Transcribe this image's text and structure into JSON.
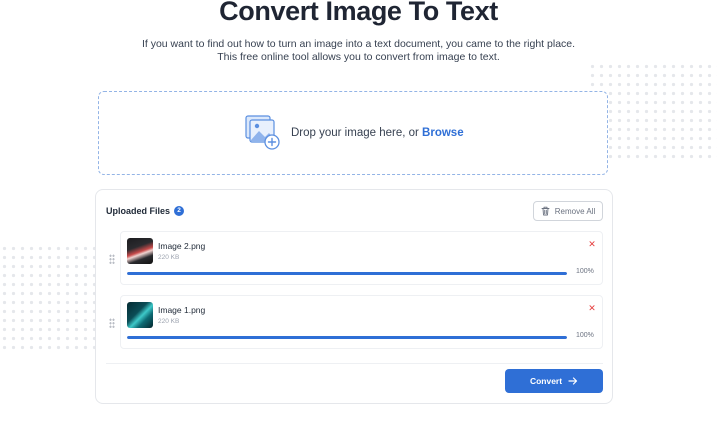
{
  "header": {
    "title": "Convert Image To Text",
    "subtitle": "If you want to find out how to turn an image into a text document, you came to the right place. This free online tool allows you to convert from image to text."
  },
  "dropzone": {
    "prompt": "Drop your image here, or ",
    "browse_label": "Browse",
    "icon": "image-upload-icon"
  },
  "uploads": {
    "title": "Uploaded Files",
    "count": "2",
    "remove_all_label": "Remove All",
    "files": [
      {
        "name": "Image 2.png",
        "size": "220 KB",
        "progress": 100,
        "progress_label": "100%"
      },
      {
        "name": "Image 1.png",
        "size": "220 KB",
        "progress": 100,
        "progress_label": "100%"
      }
    ]
  },
  "actions": {
    "convert_label": "Convert"
  },
  "colors": {
    "accent": "#2f6fd6",
    "danger": "#e53e3e"
  }
}
